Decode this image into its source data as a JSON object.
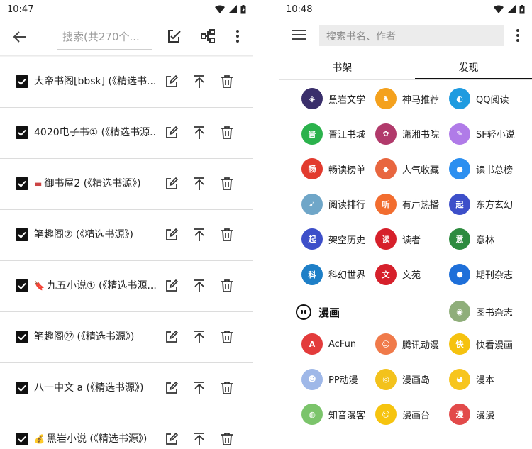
{
  "left": {
    "time": "10:47",
    "search_placeholder": "搜索(共270个...",
    "rows": [
      {
        "name": "大帝书阁[bbsk] (《精选书..."
      },
      {
        "name": "4020电子书① (《精选书源..."
      },
      {
        "name": "御书屋2 (《精选书源》)",
        "prefix_icon": "brush-icon"
      },
      {
        "name": "笔趣阁⑦ (《精选书源》)"
      },
      {
        "name": "九五小说① (《精选书源...",
        "prefix_icon": "bookmark-icon"
      },
      {
        "name": "笔趣阁㉒ (《精选书源》)"
      },
      {
        "name": "八一中文 a (《精选书源》)"
      },
      {
        "name": "黑岩小说 (《精选书源》)",
        "prefix_icon": "money-bag-icon"
      }
    ]
  },
  "right": {
    "time": "10:48",
    "search_placeholder": "搜索书名、作者",
    "tabs": [
      {
        "label": "书架"
      },
      {
        "label": "发现"
      }
    ],
    "active_tab": "发现",
    "novels": [
      {
        "label": "黑岩文学",
        "logo": "dark-crystal-icon",
        "color": "#3a2f6b",
        "glyph": "◈"
      },
      {
        "label": "神马推荐",
        "logo": "horse-icon",
        "color": "#f4a11d",
        "glyph": "♞"
      },
      {
        "label": "QQ阅读",
        "logo": "penguin-icon",
        "color": "#1f9be0",
        "glyph": "◐"
      },
      {
        "label": "晋江书城",
        "logo": "jinjiang-icon",
        "color": "#2bb24c",
        "glyph": "晋"
      },
      {
        "label": "潇湘书院",
        "logo": "xiaoxiang-icon",
        "color": "#b13a6b",
        "glyph": "✿"
      },
      {
        "label": "SF轻小说",
        "logo": "sf-icon",
        "color": "#b07be8",
        "glyph": "✎"
      },
      {
        "label": "畅读榜单",
        "logo": "changdu-icon",
        "color": "#e23b2e",
        "glyph": "畅"
      },
      {
        "label": "人气收藏",
        "logo": "popular-icon",
        "color": "#e8663f",
        "glyph": "◆"
      },
      {
        "label": "读书总榜",
        "logo": "bubble-icon",
        "color": "#2c8ff0",
        "glyph": "●"
      },
      {
        "label": "阅读排行",
        "logo": "bird-icon",
        "color": "#6fa6c8",
        "glyph": "➹"
      },
      {
        "label": "有声热播",
        "logo": "tingting-icon",
        "color": "#f26d2f",
        "glyph": "听"
      },
      {
        "label": "东方玄幻",
        "logo": "qidian-icon",
        "color": "#3d4fc9",
        "glyph": "起"
      },
      {
        "label": "架空历史",
        "logo": "qidian-icon",
        "color": "#3d4fc9",
        "glyph": "起"
      },
      {
        "label": "读者",
        "logo": "duzhe-icon",
        "color": "#d6202b",
        "glyph": "读"
      },
      {
        "label": "意林",
        "logo": "yilin-icon",
        "color": "#2d8b3f",
        "glyph": "意"
      },
      {
        "label": "科幻世界",
        "logo": "kehuan-icon",
        "color": "#1e7fc7",
        "glyph": "科"
      },
      {
        "label": "文苑",
        "logo": "wenyuan-icon",
        "color": "#d6202b",
        "glyph": "文"
      },
      {
        "label": "期刊杂志",
        "logo": "journal-icon",
        "color": "#1e6fd9",
        "glyph": "●"
      }
    ],
    "comic_title": "漫画",
    "comic_side_logo": {
      "label": "图书杂志",
      "logo": "sloth-icon",
      "color": "#8fae7a",
      "glyph": "◉"
    },
    "comics": [
      {
        "label": "AcFun",
        "logo": "acfun-icon",
        "color": "#e33b3b",
        "glyph": "A"
      },
      {
        "label": "腾讯动漫",
        "logo": "tencent-comic-icon",
        "color": "#f07a4a",
        "glyph": "☺"
      },
      {
        "label": "快看漫画",
        "logo": "kuaikan-icon",
        "color": "#f5c20f",
        "glyph": "快"
      },
      {
        "label": "PP动漫",
        "logo": "pp-icon",
        "color": "#9fb8e8",
        "glyph": "☻"
      },
      {
        "label": "漫画岛",
        "logo": "minion-icon",
        "color": "#f3c21c",
        "glyph": "◎"
      },
      {
        "label": "漫本",
        "logo": "pikachu-icon",
        "color": "#f7c51e",
        "glyph": "◕"
      },
      {
        "label": "知音漫客",
        "logo": "frog-icon",
        "color": "#7bc46b",
        "glyph": "◍"
      },
      {
        "label": "漫画台",
        "logo": "smiley-icon",
        "color": "#f6c40f",
        "glyph": "☺"
      },
      {
        "label": "漫漫",
        "logo": "manman-icon",
        "color": "#e24a4a",
        "glyph": "漫"
      }
    ]
  }
}
